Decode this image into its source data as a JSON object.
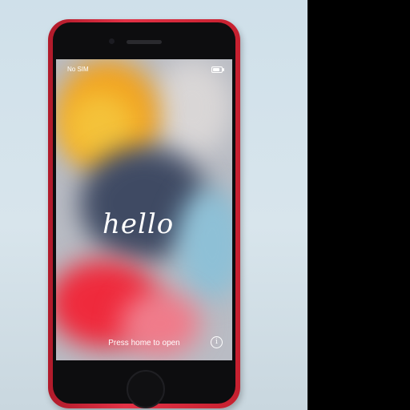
{
  "status_bar": {
    "carrier": "No SIM",
    "battery_level_percent": 80
  },
  "screen": {
    "greeting": "hello",
    "prompt": "Press home to open",
    "info_icon": "info-circle-icon"
  },
  "phone": {
    "body_color": "#e23246"
  }
}
